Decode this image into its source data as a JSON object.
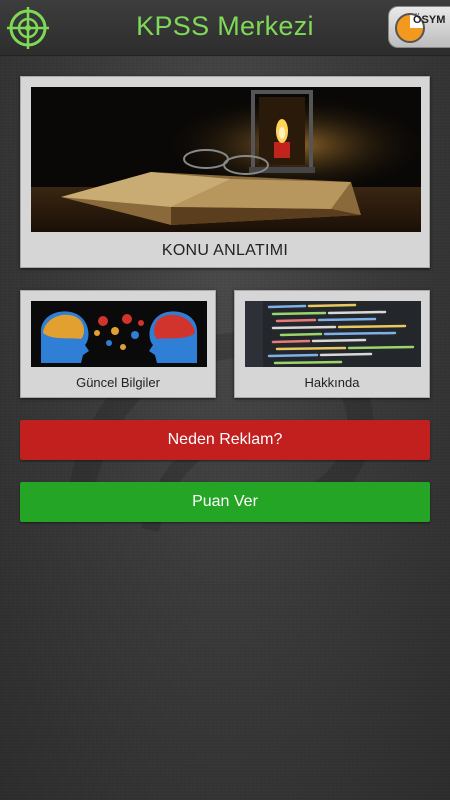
{
  "header": {
    "title": "KPSS Merkezi",
    "menu_icon": "crosshair-target-icon",
    "badge_text": "ÖSYM",
    "title_color": "#7ed957"
  },
  "cards": {
    "konu": {
      "label": "KONU ANLATIMI",
      "image": "book-candle-image"
    },
    "guncel": {
      "label": "Güncel Bilgiler",
      "image": "heads-gears-image"
    },
    "hakkinda": {
      "label": "Hakkında",
      "image": "code-screen-image"
    }
  },
  "buttons": {
    "reklam": {
      "label": "Neden Reklam?",
      "color": "#c21f1f"
    },
    "puan": {
      "label": "Puan Ver",
      "color": "#25a525"
    }
  }
}
